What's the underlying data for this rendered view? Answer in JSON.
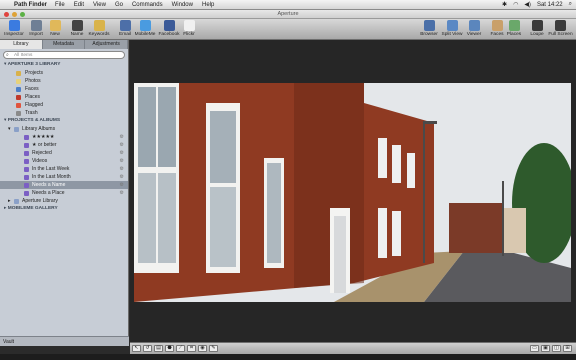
{
  "menubar": {
    "app_name": "Path Finder",
    "items": [
      "File",
      "Edit",
      "View",
      "Go",
      "Commands",
      "Window",
      "Help"
    ],
    "clock": "Sat 14:22"
  },
  "window": {
    "title": "Aperture"
  },
  "toolbar": {
    "left": [
      {
        "label": "Inspector",
        "color": "#3b7be0"
      },
      {
        "label": "Import",
        "color": "#6f7f95"
      },
      {
        "label": "New",
        "color": "#e0b85a"
      },
      {
        "label": "Name",
        "color": "#444444"
      },
      {
        "label": "Keywords",
        "color": "#d9b34a"
      },
      {
        "label": "Email",
        "color": "#4d6fa8"
      },
      {
        "label": "MobileMe",
        "color": "#4a9be0"
      },
      {
        "label": "Facebook",
        "color": "#3b5a98"
      },
      {
        "label": "Flickr",
        "color": "#f0f0f0"
      }
    ],
    "right": [
      {
        "label": "Browser",
        "color": "#4a6fa8"
      },
      {
        "label": "Split View",
        "color": "#5a88c4"
      },
      {
        "label": "Viewer",
        "color": "#5b86bd"
      },
      {
        "label": "Faces",
        "color": "#c9a06a"
      },
      {
        "label": "Places",
        "color": "#6aa86a"
      },
      {
        "label": "Loupe",
        "color": "#3a3a3a"
      },
      {
        "label": "Full Screen",
        "color": "#3a3a3a"
      }
    ]
  },
  "sidebar": {
    "tabs": [
      "Library",
      "Metadata",
      "Adjustments"
    ],
    "search_placeholder": "All Items",
    "library_header": "APERTURE 3 LIBRARY",
    "library_items": [
      {
        "label": "Projects",
        "color": "#d9b14a"
      },
      {
        "label": "Photos",
        "color": "#e8d27a"
      },
      {
        "label": "Faces",
        "color": "#4d7fc8"
      },
      {
        "label": "Places",
        "color": "#c0392b"
      },
      {
        "label": "Flagged",
        "color": "#e0533d"
      },
      {
        "label": "Trash",
        "color": "#8a8a8a"
      }
    ],
    "projects_header": "PROJECTS & ALBUMS",
    "library_albums_label": "Library Albums",
    "albums": [
      {
        "label": "★★★★★",
        "selected": false
      },
      {
        "label": "★ or better",
        "selected": false
      },
      {
        "label": "Rejected",
        "selected": false
      },
      {
        "label": "Videos",
        "selected": false
      },
      {
        "label": "In the Last Week",
        "selected": false
      },
      {
        "label": "In the Last Month",
        "selected": false
      },
      {
        "label": "Needs a Name",
        "selected": true
      },
      {
        "label": "Needs a Place",
        "selected": false
      }
    ],
    "aperture_library_label": "Aperture Library",
    "mobileme_header": "MOBILEME GALLERY",
    "vault_label": "Vault"
  },
  "viewer": {
    "photo_colors": {
      "sky": "#e4e7ea",
      "brick": "#8f3a22",
      "brick_dark": "#6e2a18",
      "road": "#5a5a5e",
      "pavement": "#a8926c",
      "trees": "#2e5a2c"
    }
  }
}
